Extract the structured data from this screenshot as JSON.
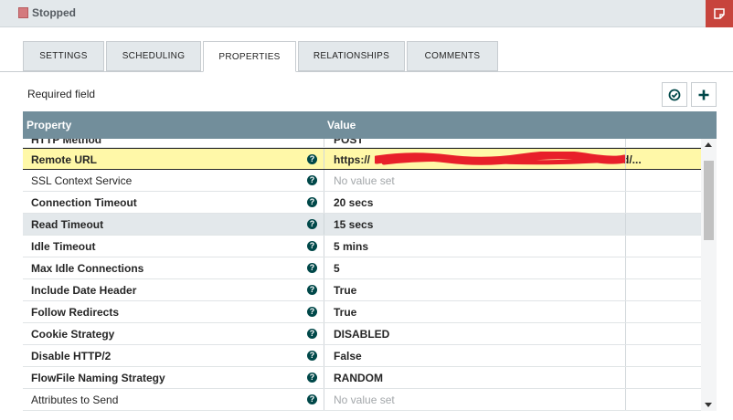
{
  "window": {
    "status": "Stopped"
  },
  "tabs": [
    {
      "label": "SETTINGS"
    },
    {
      "label": "SCHEDULING"
    },
    {
      "label": "PROPERTIES",
      "active": true
    },
    {
      "label": "RELATIONSHIPS"
    },
    {
      "label": "COMMENTS"
    }
  ],
  "toolbar": {
    "required_label": "Required field"
  },
  "table": {
    "header_property": "Property",
    "header_value": "Value",
    "rows": [
      {
        "name": "HTTP Method",
        "value": "POST"
      },
      {
        "name": "Remote URL",
        "value": "https://                       d/..."
      },
      {
        "name": "SSL Context Service",
        "value": "No value set"
      },
      {
        "name": "Connection Timeout",
        "value": "20 secs"
      },
      {
        "name": "Read Timeout",
        "value": "15 secs"
      },
      {
        "name": "Idle Timeout",
        "value": "5 mins"
      },
      {
        "name": "Max Idle Connections",
        "value": "5"
      },
      {
        "name": "Include Date Header",
        "value": "True"
      },
      {
        "name": "Follow Redirects",
        "value": "True"
      },
      {
        "name": "Cookie Strategy",
        "value": "DISABLED"
      },
      {
        "name": "Disable HTTP/2",
        "value": "False"
      },
      {
        "name": "FlowFile Naming Strategy",
        "value": "RANDOM"
      },
      {
        "name": "Attributes to Send",
        "value": "No value set"
      }
    ]
  },
  "colors": {
    "header_bg": "#728e9b",
    "selected_row": "#fff8a8",
    "close_button": "#c7443c",
    "help_icon": "#004849"
  },
  "icons": {
    "status": "stopped-square-icon",
    "window_action": "note-icon",
    "verify": "check-circle-icon",
    "add": "plus-icon",
    "help": "question-circle-icon"
  }
}
